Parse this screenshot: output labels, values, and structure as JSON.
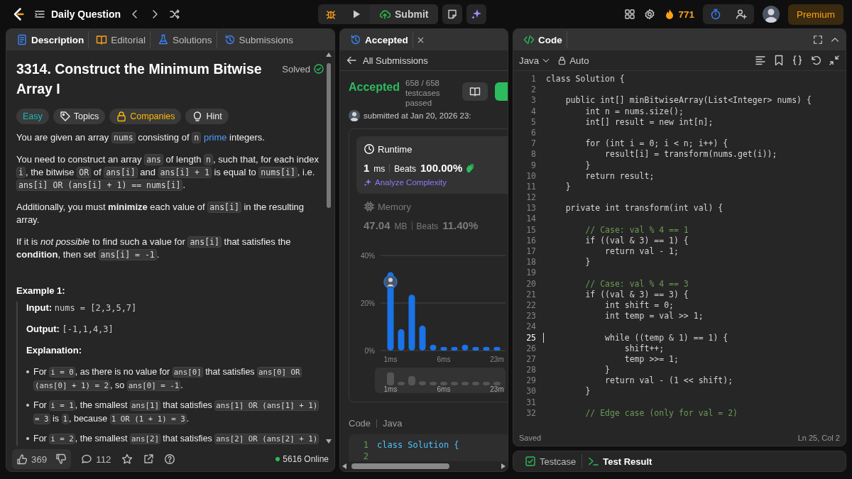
{
  "topbar": {
    "title": "Daily Question",
    "submit": "Submit",
    "streak": "771",
    "premium": "Premium"
  },
  "description_panel": {
    "tabs": [
      {
        "label": "Description",
        "kind": "description",
        "selected": true
      },
      {
        "label": "Editorial",
        "kind": "editorial",
        "selected": false
      },
      {
        "label": "Solutions",
        "kind": "solutions",
        "selected": false
      },
      {
        "label": "Submissions",
        "kind": "submissions",
        "selected": false
      }
    ],
    "title": "3314. Construct the Minimum Bitwise Array I",
    "status": "Solved",
    "tags": [
      {
        "label": "Easy",
        "kind": "difficulty"
      },
      {
        "label": "Topics",
        "kind": "topics"
      },
      {
        "label": "Companies",
        "kind": "companies"
      },
      {
        "label": "Hint",
        "kind": "hint"
      }
    ],
    "paragraphs": [
      [
        {
          "kind": "text",
          "text": "You are given an array "
        },
        {
          "kind": "code",
          "text": "nums"
        },
        {
          "kind": "text",
          "text": " consisting of "
        },
        {
          "kind": "code",
          "text": "n"
        },
        {
          "kind": "link",
          "text": "prime"
        },
        {
          "kind": "text",
          "text": " integers."
        }
      ],
      [
        {
          "kind": "text",
          "text": "You need to construct an array "
        },
        {
          "kind": "code",
          "text": "ans"
        },
        {
          "kind": "text",
          "text": " of length "
        },
        {
          "kind": "code",
          "text": "n"
        },
        {
          "kind": "text",
          "text": ", such that, for each index "
        },
        {
          "kind": "code",
          "text": "i"
        },
        {
          "kind": "text",
          "text": ", the bitwise "
        },
        {
          "kind": "code",
          "text": "OR"
        },
        {
          "kind": "text",
          "text": " of "
        },
        {
          "kind": "code",
          "text": "ans[i]"
        },
        {
          "kind": "text",
          "text": " and "
        },
        {
          "kind": "code",
          "text": "ans[i] + 1"
        },
        {
          "kind": "text",
          "text": " is equal to "
        },
        {
          "kind": "code",
          "text": "nums[i]"
        },
        {
          "kind": "text",
          "text": ", i.e. "
        },
        {
          "kind": "code",
          "text": "ans[i] OR (ans[i] + 1) == nums[i]"
        },
        {
          "kind": "text",
          "text": "."
        }
      ],
      [
        {
          "kind": "text",
          "text": "Additionally, you must **minimize** each value of "
        },
        {
          "kind": "code",
          "text": "ans[i]"
        },
        {
          "kind": "text",
          "text": " in the resulting array."
        }
      ],
      [
        {
          "kind": "text",
          "text": "If it is *not possible* to find such a value for "
        },
        {
          "kind": "code",
          "text": "ans[i]"
        },
        {
          "kind": "text",
          "text": " that satisfies the **condition**, then set "
        },
        {
          "kind": "code",
          "text": "ans[i] = -1"
        },
        {
          "kind": "text",
          "text": "."
        }
      ]
    ],
    "example": {
      "title": "Example 1:",
      "input_label": "Input:",
      "input": "nums = [2,3,5,7]",
      "output_label": "Output:",
      "output": "[-1,1,4,3]",
      "explanation_label": "Explanation:",
      "bullets": [
        [
          {
            "kind": "text",
            "text": "For "
          },
          {
            "kind": "code",
            "text": "i = 0"
          },
          {
            "kind": "text",
            "text": ", as there is no value for "
          },
          {
            "kind": "code",
            "text": "ans[0]"
          },
          {
            "kind": "text",
            "text": " that satisfies "
          },
          {
            "kind": "code",
            "text": "ans[0] OR (ans[0] + 1) = 2"
          },
          {
            "kind": "text",
            "text": ", so "
          },
          {
            "kind": "code",
            "text": "ans[0] = -1"
          },
          {
            "kind": "text",
            "text": "."
          }
        ],
        [
          {
            "kind": "text",
            "text": "For "
          },
          {
            "kind": "code",
            "text": "i = 1"
          },
          {
            "kind": "text",
            "text": ", the smallest "
          },
          {
            "kind": "code",
            "text": "ans[1]"
          },
          {
            "kind": "text",
            "text": " that satisfies "
          },
          {
            "kind": "code",
            "text": "ans[1] OR (ans[1] + 1) = 3"
          },
          {
            "kind": "text",
            "text": " is "
          },
          {
            "kind": "code",
            "text": "1"
          },
          {
            "kind": "text",
            "text": ", because "
          },
          {
            "kind": "code",
            "text": "1 OR (1 + 1) = 3"
          },
          {
            "kind": "text",
            "text": "."
          }
        ],
        [
          {
            "kind": "text",
            "text": "For "
          },
          {
            "kind": "code",
            "text": "i = 2"
          },
          {
            "kind": "text",
            "text": ", the smallest "
          },
          {
            "kind": "code",
            "text": "ans[2]"
          },
          {
            "kind": "text",
            "text": " that satisfies "
          },
          {
            "kind": "code",
            "text": "ans[2] OR (ans[2] + 1)"
          }
        ]
      ]
    },
    "footer": {
      "likes": "369",
      "comments": "112",
      "online": "5616 Online"
    }
  },
  "submission_panel": {
    "tab": "Accepted",
    "back": "All Submissions",
    "status": "Accepted",
    "testcases": "658 / 658 testcases passed",
    "submitted": "submitted at Jan 20, 2026 23:",
    "metrics": [
      {
        "kind": "runtime",
        "label": "Runtime",
        "value": "1",
        "unit": "ms",
        "beats_label": "Beats",
        "beats": "100.00%",
        "analyze": "Analyze Complexity",
        "selected": true
      },
      {
        "kind": "memory",
        "label": "Memory",
        "value": "47.04",
        "unit": "MB",
        "beats_label": "Beats",
        "beats": "11.40%",
        "selected": false
      }
    ],
    "chart_data": {
      "type": "bar",
      "categories": [
        "1ms",
        null,
        null,
        null,
        null,
        "6ms",
        null,
        null,
        null,
        null,
        "23m"
      ],
      "values": [
        33,
        9,
        23.5,
        10.5,
        2.5,
        1.5,
        1.5,
        2.5,
        1.5,
        1.5,
        1.5
      ],
      "ylim": [
        0,
        40
      ],
      "yticks": [
        {
          "value": 0,
          "label": "0%"
        },
        {
          "value": 20,
          "label": "20%"
        },
        {
          "value": 40,
          "label": "40%"
        }
      ]
    },
    "overview_labels": [
      "1ms",
      "6ms",
      "23m"
    ],
    "code_label": "Code",
    "language": "Java",
    "code_lines": [
      {
        "number": "1",
        "text": "class Solution {"
      },
      {
        "number": "2"
      }
    ]
  },
  "editor": {
    "tab": "Code",
    "language": "Java",
    "mode": "Auto",
    "lines": [
      {
        "number": "1",
        "text": "class Solution {",
        "kind": "code",
        "current": false
      },
      {
        "number": "2",
        "current": false
      },
      {
        "number": "3",
        "text": "    public int[] minBitwiseArray(List<Integer> nums) {",
        "kind": "code",
        "current": false
      },
      {
        "number": "4",
        "text": "        int n = nums.size();",
        "kind": "code",
        "current": false
      },
      {
        "number": "5",
        "text": "        int[] result = new int[n];",
        "kind": "code",
        "current": false
      },
      {
        "number": "6",
        "current": false
      },
      {
        "number": "7",
        "text": "        for (int i = 0; i < n; i++) {",
        "kind": "code",
        "current": false
      },
      {
        "number": "8",
        "text": "            result[i] = transform(nums.get(i));",
        "kind": "code",
        "current": false
      },
      {
        "number": "9",
        "text": "        }",
        "kind": "code",
        "current": false
      },
      {
        "number": "10",
        "text": "        return result;",
        "kind": "code",
        "current": false
      },
      {
        "number": "11",
        "text": "    }",
        "kind": "code",
        "current": false
      },
      {
        "number": "12",
        "current": false
      },
      {
        "number": "13",
        "text": "    private int transform(int val) {",
        "kind": "code",
        "current": false
      },
      {
        "number": "14",
        "current": false
      },
      {
        "number": "15",
        "text": "        // Case: val % 4 == 1",
        "kind": "comment",
        "current": false
      },
      {
        "number": "16",
        "text": "        if ((val & 3) == 1) {",
        "kind": "code",
        "current": false
      },
      {
        "number": "17",
        "text": "            return val - 1;",
        "kind": "code",
        "current": false
      },
      {
        "number": "18",
        "text": "        }",
        "kind": "code",
        "current": false
      },
      {
        "number": "19",
        "current": false
      },
      {
        "number": "20",
        "text": "        // Case: val % 4 == 3",
        "kind": "comment",
        "current": false
      },
      {
        "number": "21",
        "text": "        if ((val & 3) == 3) {",
        "kind": "code",
        "current": false
      },
      {
        "number": "22",
        "text": "            int shift = 0;",
        "kind": "code",
        "current": false
      },
      {
        "number": "23",
        "text": "            int temp = val >> 1;",
        "kind": "code",
        "current": false
      },
      {
        "number": "24",
        "current": false
      },
      {
        "number": "25",
        "text": "            while ((temp & 1) == 1) {",
        "kind": "code",
        "current": true
      },
      {
        "number": "26",
        "text": "                shift++;",
        "kind": "code",
        "current": false
      },
      {
        "number": "27",
        "text": "                temp >>= 1;",
        "kind": "code",
        "current": false
      },
      {
        "number": "28",
        "text": "            }",
        "kind": "code",
        "current": false
      },
      {
        "number": "29",
        "text": "            return val - (1 << shift);",
        "kind": "code",
        "current": false
      },
      {
        "number": "30",
        "text": "        }",
        "kind": "code",
        "current": false
      },
      {
        "number": "31",
        "current": false
      },
      {
        "number": "32",
        "text": "        // Edge case (only for val = 2)",
        "kind": "comment",
        "current": false
      }
    ],
    "status": "Saved",
    "cursor": "Ln 25, Col 2"
  },
  "bottom_tabs": [
    {
      "label": "Testcase",
      "kind": "testcase",
      "selected": false
    },
    {
      "label": "Test Result",
      "kind": "result",
      "selected": true
    }
  ]
}
